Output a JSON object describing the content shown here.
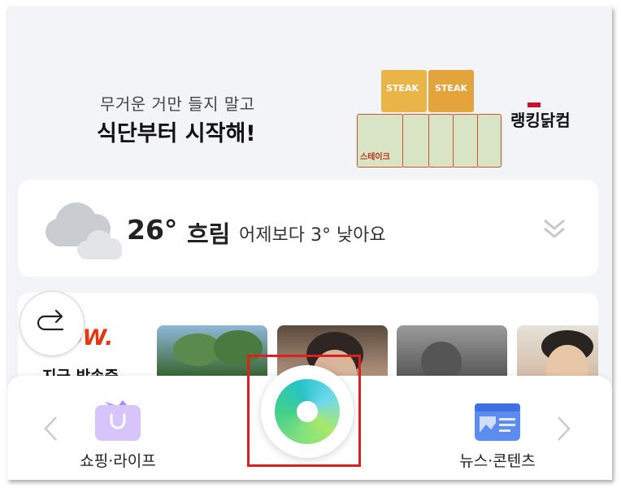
{
  "ad": {
    "subtitle": "무거운 거만 들지 말고",
    "headline": "식단부터 시작해!",
    "brand": "랭킹닭컴",
    "product_label_top": "STEAK",
    "product_label_bottom": "스테이크"
  },
  "weather": {
    "temperature": "26°",
    "condition": "흐림",
    "comparison": "어제보다 3° 낮아요"
  },
  "broadcast": {
    "logo": "NOW.",
    "title": "지금 방송중"
  },
  "bottom_nav": {
    "left_label": "쇼핑·라이프",
    "right_label": "뉴스·콘텐츠"
  },
  "colors": {
    "accent_green": "#3fcf8e",
    "now_red": "#e8360f",
    "highlight_red": "#e01e1e"
  }
}
